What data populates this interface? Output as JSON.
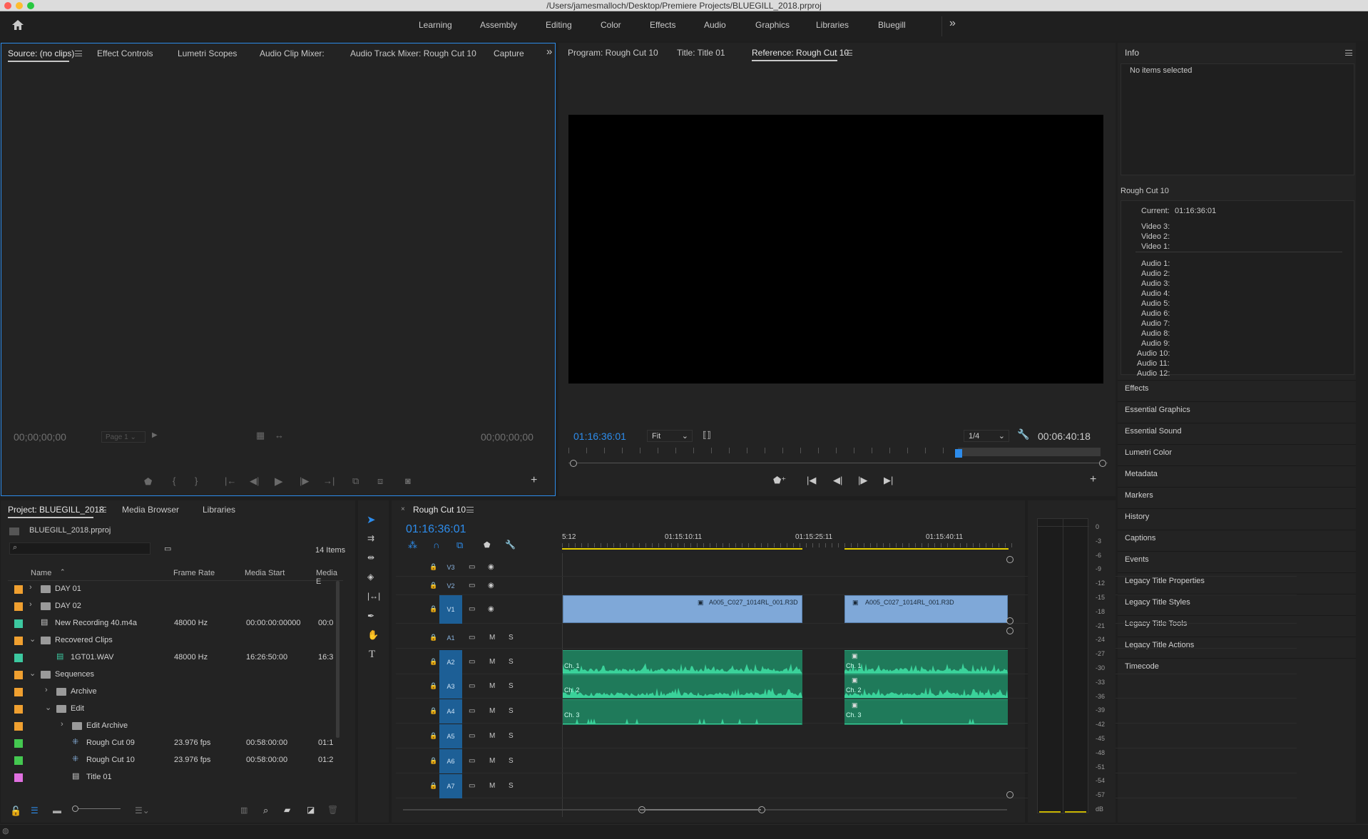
{
  "window": {
    "title": "/Users/jamesmalloch/Desktop/Premiere Projects/BLUEGILL_2018.prproj"
  },
  "workspaces": {
    "items": [
      "Learning",
      "Assembly",
      "Editing",
      "Color",
      "Effects",
      "Audio",
      "Graphics",
      "Libraries",
      "Bluegill"
    ],
    "more": "»"
  },
  "source_panel": {
    "tabs": [
      "Source: (no clips)",
      "Effect Controls",
      "Lumetri Scopes",
      "Audio Clip Mixer:",
      "Audio Track Mixer: Rough Cut 10",
      "Capture"
    ],
    "more": "»",
    "timecode_in": "00;00;00;00",
    "timecode_out": "00;00;00;00",
    "page": "Page 1"
  },
  "program_panel": {
    "tabs": [
      "Program: Rough Cut 10",
      "Title: Title 01",
      "Reference: Rough Cut 10"
    ],
    "timecode": "01:16:36:01",
    "fit": "Fit",
    "resolution": "1/4",
    "duration": "00:06:40:18"
  },
  "info_panel": {
    "title": "Info",
    "message": "No items selected",
    "sequence_name": "Rough Cut 10",
    "current_label": "Current:",
    "current_value": "01:16:36:01",
    "video_lines": [
      "Video 3:",
      "Video 2:",
      "Video 1:"
    ],
    "audio_lines": [
      "Audio 1:",
      "Audio 2:",
      "Audio 3:",
      "Audio 4:",
      "Audio 5:",
      "Audio 6:",
      "Audio 7:",
      "Audio 8:",
      "Audio 9:",
      "Audio 10:",
      "Audio 11:",
      "Audio 12:"
    ]
  },
  "side_panels": [
    "Effects",
    "Essential Graphics",
    "Essential Sound",
    "Lumetri Color",
    "Metadata",
    "Markers",
    "History",
    "Captions",
    "Events",
    "Legacy Title Properties",
    "Legacy Title Styles",
    "Legacy Title Tools",
    "Legacy Title Actions",
    "Timecode"
  ],
  "project_panel": {
    "tabs": [
      "Project: BLUEGILL_2018",
      "Media Browser",
      "Libraries"
    ],
    "file": "BLUEGILL_2018.prproj",
    "count": "14 Items",
    "columns": [
      "Name",
      "Frame Rate",
      "Media Start",
      "Media E"
    ],
    "rows": [
      {
        "name": "DAY 01",
        "color": "#f0a030",
        "fr": "",
        "ms": "",
        "me": ""
      },
      {
        "name": "DAY 02",
        "color": "#f0a030",
        "fr": "",
        "ms": "",
        "me": ""
      },
      {
        "name": "New Recording 40.m4a",
        "color": "#3cc8a0",
        "fr": "48000 Hz",
        "ms": "00:00:00:00000",
        "me": "00:0"
      },
      {
        "name": "Recovered Clips",
        "color": "#f0a030",
        "fr": "",
        "ms": "",
        "me": ""
      },
      {
        "name": "1GT01.WAV",
        "color": "#3cc8a0",
        "fr": "48000 Hz",
        "ms": "16:26:50:00",
        "me": "16:3"
      },
      {
        "name": "Sequences",
        "color": "#f0a030",
        "fr": "",
        "ms": "",
        "me": ""
      },
      {
        "name": "Archive",
        "color": "#f0a030",
        "fr": "",
        "ms": "",
        "me": ""
      },
      {
        "name": "Edit",
        "color": "#f0a030",
        "fr": "",
        "ms": "",
        "me": ""
      },
      {
        "name": "Edit Archive",
        "color": "#f0a030",
        "fr": "",
        "ms": "",
        "me": ""
      },
      {
        "name": "Rough Cut 09",
        "color": "#44c850",
        "fr": "23.976 fps",
        "ms": "00:58:00:00",
        "me": "01:1"
      },
      {
        "name": "Rough Cut 10",
        "color": "#44c850",
        "fr": "23.976 fps",
        "ms": "00:58:00:00",
        "me": "01:2"
      },
      {
        "name": "Title 01",
        "color": "#e070e0",
        "fr": "",
        "ms": "",
        "me": ""
      }
    ]
  },
  "timeline": {
    "tab": "Rough Cut 10",
    "timecode": "01:16:36:01",
    "ruler": [
      "5:12",
      "01:15:10:11",
      "01:15:25:11",
      "01:15:40:11"
    ],
    "video_tracks": [
      "V3",
      "V2",
      "V1"
    ],
    "audio_tracks": [
      "A1",
      "A2",
      "A3",
      "A4",
      "A5",
      "A6",
      "A7"
    ],
    "clip_name": "A005_C027_1014RL_001.R3D",
    "channels": [
      "Ch. 1",
      "Ch. 2",
      "Ch. 3"
    ],
    "m": "M",
    "s": "S"
  },
  "meter": {
    "labels": [
      "0",
      "-3",
      "-6",
      "-9",
      "-12",
      "-15",
      "-18",
      "-21",
      "-24",
      "-27",
      "-30",
      "-33",
      "-36",
      "-39",
      "-42",
      "-45",
      "-48",
      "-51",
      "-54",
      "-57",
      "dB"
    ]
  },
  "colors": {
    "accent": "#2d8ceb",
    "video_clip": "#7fa8d8",
    "audio_clip": "#1f7a5a",
    "track_select": "#1d5f96"
  }
}
